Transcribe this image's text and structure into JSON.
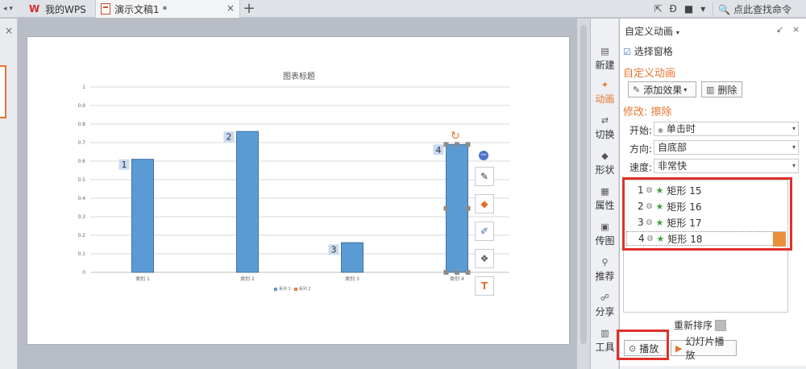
{
  "tabbar": {
    "left_glyph": "◂ ▾",
    "wps_logo": "W",
    "wps_tab": "我的WPS",
    "doc_tab": "演示文稿1 *",
    "close_glyph": "×",
    "add_glyph": "+",
    "tools": [
      "⇱",
      "Ð",
      "■",
      "▾"
    ],
    "search_command": "点此查找命令"
  },
  "slide": {
    "chart_data": {
      "type": "bar",
      "title": "图表标题",
      "categories": [
        "类别 1",
        "类别 2",
        "类别 3",
        "类别 4"
      ],
      "series": [
        {
          "name": "系列 1",
          "values": [
            0.61,
            0.76,
            0.16,
            0.69
          ],
          "color": "#5b9bd5"
        },
        {
          "name": "系列 2",
          "values": [],
          "color": "#ed7d31"
        }
      ],
      "ylim": [
        0,
        1
      ],
      "yticks": [
        "0",
        "0.1",
        "0.2",
        "0.3",
        "0.4",
        "0.5",
        "0.6",
        "0.7",
        "0.8",
        "0.9",
        "1"
      ],
      "grid": true,
      "legend": "bottom",
      "animation_labels": [
        "1",
        "2",
        "3",
        "4"
      ]
    },
    "selected_bar_index": 3,
    "chart_tools": [
      "pen-icon",
      "fill-bucket-icon",
      "line-style-icon",
      "layers-icon",
      "text-fill-icon"
    ],
    "tool_glyphs": [
      "✎",
      "◆",
      "✐",
      "❖",
      "T"
    ],
    "minus_glyph": "−",
    "rotate_glyph": "↻"
  },
  "sidetabs": [
    {
      "label": "新建",
      "icon": "▤"
    },
    {
      "label": "动画",
      "icon": "✦",
      "active": true
    },
    {
      "label": "切换",
      "icon": "⇄"
    },
    {
      "label": "形状",
      "icon": "◆"
    },
    {
      "label": "属性",
      "icon": "▦"
    },
    {
      "label": "传图",
      "icon": "▣"
    },
    {
      "label": "推荐",
      "icon": "⚲"
    },
    {
      "label": "分享",
      "icon": "☍"
    },
    {
      "label": "工具",
      "icon": "▥"
    }
  ],
  "panel": {
    "title": "自定义动画",
    "title_caret": "▾",
    "pin_glyph": "↙",
    "close_glyph": "×",
    "select_pane": "选择窗格",
    "select_pane_icon": "☑",
    "section_title": "自定义动画",
    "add_effect": "添加效果",
    "add_effect_icon": "✎",
    "caret": "▾",
    "delete": "删除",
    "delete_icon": "▥",
    "modify_title": "修改: 擦除",
    "fields": [
      {
        "label": "开始:",
        "value": "单击时",
        "value_icon": "◉"
      },
      {
        "label": "方向:",
        "value": "自底部"
      },
      {
        "label": "速度:",
        "value": "非常快"
      }
    ],
    "list_item_mouse": "◍",
    "list_item_star": "★",
    "animation_list": [
      {
        "num": "1",
        "name": "矩形 15"
      },
      {
        "num": "2",
        "name": "矩形 16"
      },
      {
        "num": "3",
        "name": "矩形 17"
      },
      {
        "num": "4",
        "name": "矩形 18",
        "selected": true
      }
    ],
    "reorder": "重新排序",
    "play": "播放",
    "play_icon": "⊙",
    "slideshow": "幻灯片播放",
    "slideshow_icon": "▶"
  }
}
